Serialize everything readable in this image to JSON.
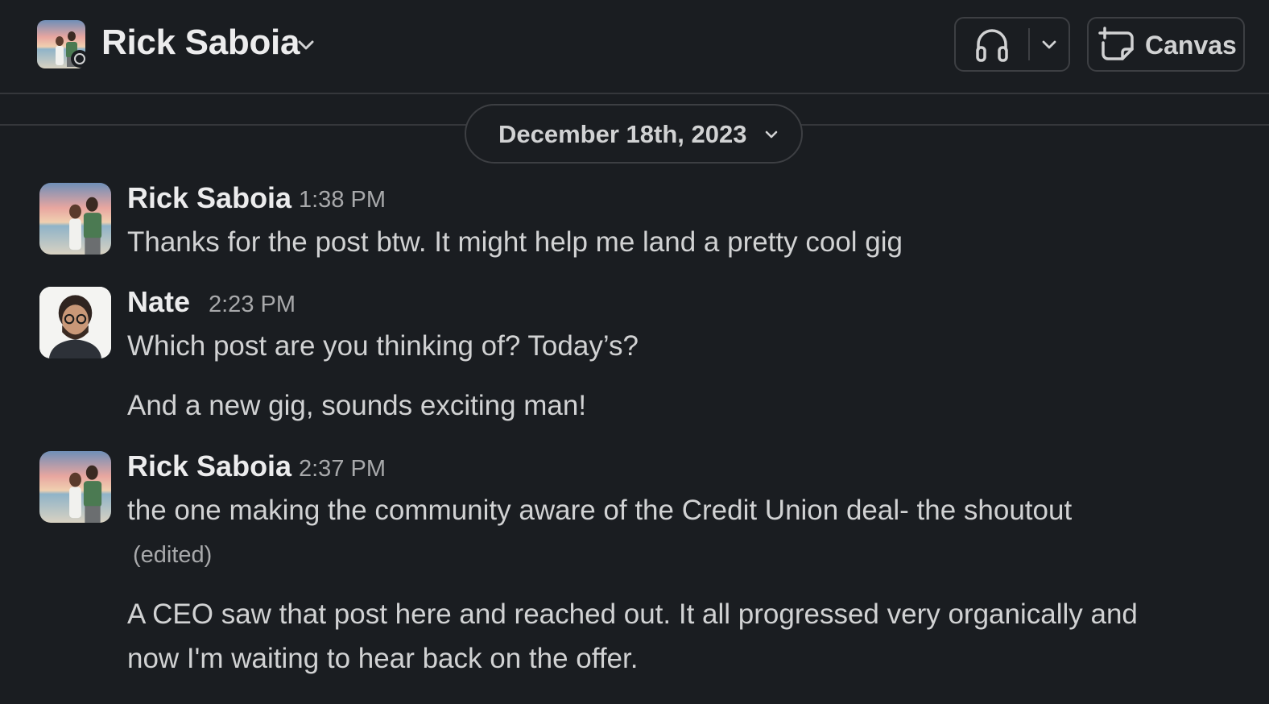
{
  "header": {
    "title": "Rick Saboia",
    "avatar": "beach-couple-photo",
    "presence": "away",
    "huddle_icon": "headphones-icon",
    "huddle_dropdown_icon": "chevron-down-icon",
    "canvas_icon": "canvas-icon",
    "canvas_label": "Canvas"
  },
  "date_divider": {
    "label": "December 18th, 2023",
    "icon": "chevron-down-icon"
  },
  "messages": [
    {
      "author": "Rick Saboia",
      "time": "1:38 PM",
      "avatar": "beach-couple-photo",
      "lines": [
        "Thanks for the post btw. It might help me land a pretty cool gig"
      ]
    },
    {
      "author": "Nate",
      "time": "2:23 PM",
      "avatar": "man-with-glasses-photo",
      "lines": [
        "Which post are you thinking of? Today’s?",
        "And a new gig, sounds exciting man!"
      ]
    },
    {
      "author": "Rick Saboia",
      "time": "2:37 PM",
      "avatar": "beach-couple-photo",
      "lines": [
        "the one making the community aware of the Credit Union deal- the shoutout",
        "A CEO saw that post here and reached out. It all progressed very organically  and",
        "now I'm waiting to hear back on the offer."
      ],
      "edited_label": "(edited)"
    }
  ],
  "colors": {
    "background": "#1a1d21",
    "text": "#d1d2d3",
    "muted": "#a8a9ab",
    "border": "#3d3f43"
  }
}
